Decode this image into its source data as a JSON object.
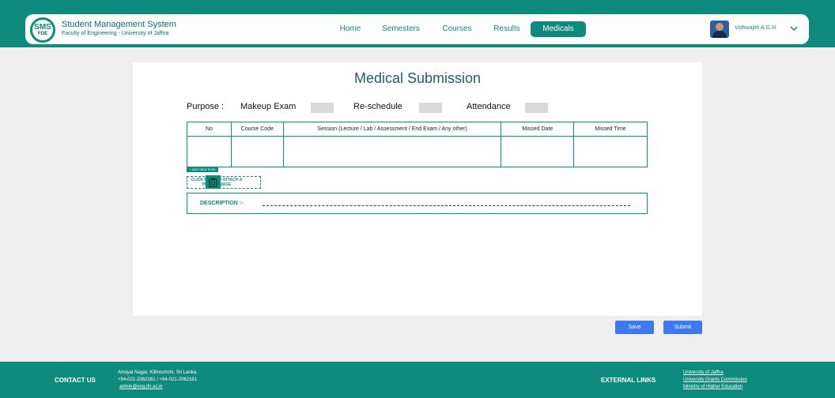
{
  "header": {
    "logo_top": "SMS",
    "logo_bottom": "FOE",
    "brand_title": "Student Management System",
    "brand_subtitle": "Faculty of Engineering - University of Jaffna",
    "nav": [
      {
        "label": "Home",
        "active": false
      },
      {
        "label": "Semesters",
        "active": false
      },
      {
        "label": "Courses",
        "active": false
      },
      {
        "label": "Results",
        "active": false
      },
      {
        "label": "Medicals",
        "active": true
      }
    ],
    "user_name": "Vishwajith A.G.N"
  },
  "main": {
    "title": "Medical Submission",
    "purpose_label": "Purpose :",
    "purpose_options": [
      "Makeup Exam",
      "Re-schedule",
      "Attendance"
    ],
    "table": {
      "columns": [
        "No",
        "Course Code",
        "Session (Lecture / Lab / Assessment / End Exam / Any other)",
        "Missed Date",
        "Missed Time"
      ]
    },
    "add_row_label": "+ ADD NEW ROW",
    "attach_label": "CLICK HERE TO ATTACH A PDF OR IMAGE",
    "description_label": "DESCRIPTION :-"
  },
  "actions": {
    "save_label": "Save",
    "submit_label": "Submit"
  },
  "footer": {
    "contact_title": "CONTACT US",
    "address": "Ariviyal Nagar, Killinochchi, Sri Lanka.",
    "phone": "+94-021-2062161 / +94-021-2062161",
    "email": "admin@eng.jfn.ac.lk",
    "external_title": "EXTERNAL LINKS",
    "links": [
      "University of Jaffna",
      "University Grants Commission",
      "Ministry of Higher Education"
    ]
  },
  "colors": {
    "primary": "#0e8b7c",
    "button_blue": "#3e78f2",
    "background": "#efefef"
  }
}
